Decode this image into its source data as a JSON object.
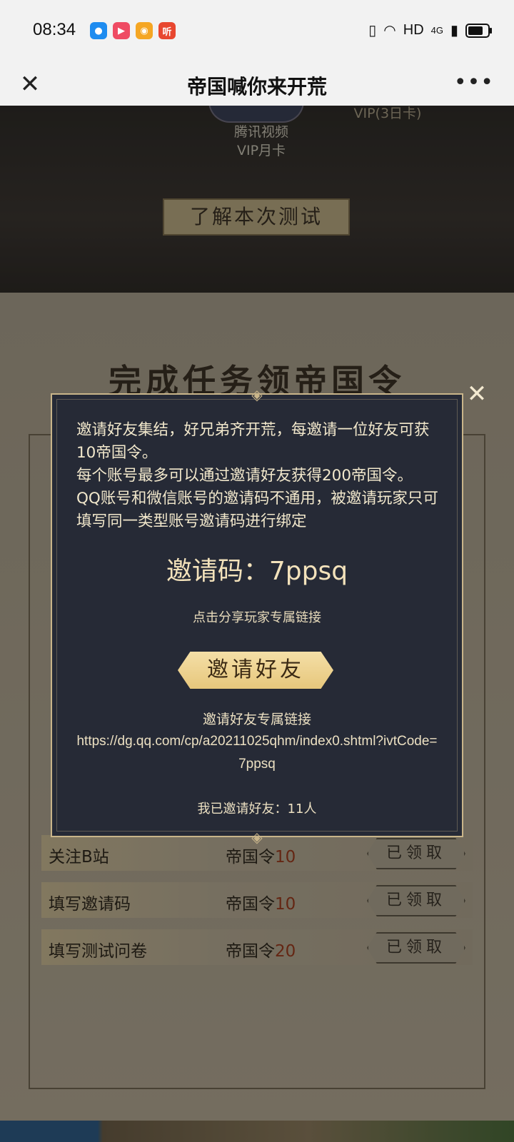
{
  "status": {
    "time": "08:34",
    "apps": [
      {
        "icon": "app-circle-icon",
        "color": "#1e8cf0",
        "glyph": "●"
      },
      {
        "icon": "video-play-icon",
        "color": "#ef4b63",
        "glyph": "▶"
      },
      {
        "icon": "weibo-icon",
        "color": "#f5a623",
        "glyph": "◉"
      },
      {
        "icon": "listen-app-icon",
        "color": "#e8472f",
        "glyph": "听"
      }
    ],
    "network": "HD",
    "signal": "4G",
    "battery_level": 0.75
  },
  "titlebar": {
    "title": "帝国喊你来开荒",
    "close_glyph": "✕",
    "more_glyph": "•••"
  },
  "page": {
    "reward_label": "腾讯视频\nVIP月卡",
    "vip_label": "VIP(3日卡)",
    "learn_button": "了解本次测试",
    "task_title": "完成任务领帝国令",
    "tasks": [
      {
        "name": "关注B站",
        "reward_prefix": "帝国令",
        "reward_value": "10",
        "status": "已领取"
      },
      {
        "name": "填写邀请码",
        "reward_prefix": "帝国令",
        "reward_value": "10",
        "status": "已领取"
      },
      {
        "name": "填写测试问卷",
        "reward_prefix": "帝国令",
        "reward_value": "20",
        "status": "已领取"
      }
    ]
  },
  "modal": {
    "description": [
      "邀请好友集结，好兄弟齐开荒，每邀请一位好友可获10帝国令。",
      "每个账号最多可以通过邀请好友获得200帝国令。",
      "QQ账号和微信账号的邀请码不通用，被邀请玩家只可填写同一类型账号邀请码进行绑定"
    ],
    "code_text": "邀请码：7ppsq",
    "share_hint": "点击分享玩家专属链接",
    "invite_button": "邀请好友",
    "link_label": "邀请好友专属链接",
    "link_url": "https://dg.qq.com/cp/a20211025qhm/index0.shtml?ivtCode=7ppsq",
    "invited_count": "我已邀请好友：11人",
    "close_glyph": "✕"
  }
}
